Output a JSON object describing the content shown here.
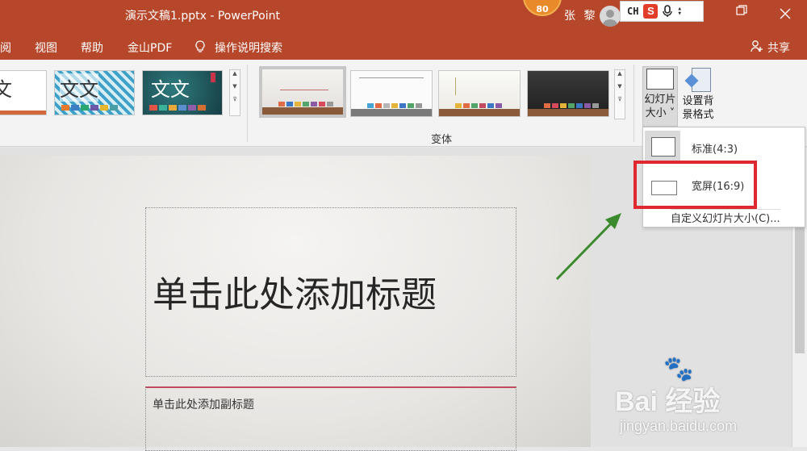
{
  "titlebar": {
    "title": "演示文稿1.pptx  -  PowerPoint",
    "badge": "80",
    "username": "张 黎",
    "ime": {
      "lang": "CH",
      "logo": "S"
    },
    "restore_icon": "restore-icon",
    "close_icon": "close-icon"
  },
  "menu": {
    "items": [
      "阅",
      "视图",
      "帮助",
      "金山PDF",
      "操作说明搜索"
    ],
    "share": "共享"
  },
  "ribbon": {
    "themes": [
      {
        "text": "文"
      },
      {
        "text": "文文"
      },
      {
        "text": "文文"
      }
    ],
    "variants_label": "变体",
    "slide_size": {
      "line1": "幻灯片",
      "line2": "大小 ˅"
    },
    "format_bg": {
      "line1": "设置背",
      "line2": "景格式"
    }
  },
  "slide": {
    "title_placeholder": "单击此处添加标题",
    "subtitle_placeholder": "单击此处添加副标题"
  },
  "dropdown": {
    "standard": "标准(4:3)",
    "widescreen": "宽屏(16:9)",
    "custom": "自定义幻灯片大小(C)..."
  },
  "watermark": {
    "brand": "Bai  经验",
    "url": "jingyan.baidu.com"
  },
  "colors": {
    "titlebar": "#b7472a",
    "highlight": "#e0282f",
    "arrow": "#3c8a2e"
  }
}
